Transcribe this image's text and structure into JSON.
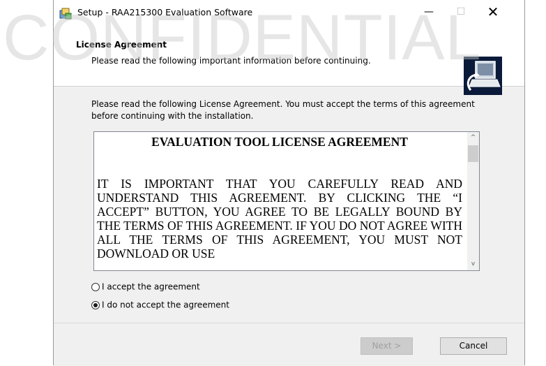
{
  "watermark": "CONFIDENTIAL",
  "window": {
    "title": "Setup - RAA215300 Evaluation Software",
    "minimize_glyph": "—",
    "maximize_glyph": "☐",
    "close_glyph": "✕"
  },
  "header": {
    "title": "License Agreement",
    "subtitle": "Please read the following important information before continuing."
  },
  "content": {
    "intro": "Please read the following License Agreement. You must accept the terms of this agreement before continuing with the installation.",
    "license_heading": "EVALUATION TOOL LICENSE AGREEMENT",
    "license_body": "IT IS IMPORTANT THAT YOU CAREFULLY READ AND UNDERSTAND THIS AGREEMENT. BY CLICKING THE “I ACCEPT” BUTTON, YOU AGREE TO BE LEGALLY BOUND BY THE TERMS OF THIS AGREEMENT. IF YOU DO NOT AGREE WITH ALL THE TERMS OF THIS AGREEMENT, YOU MUST NOT DOWNLOAD OR USE",
    "scroll_up_glyph": "^",
    "scroll_down_glyph": "v",
    "radio_accept": "I accept the agreement",
    "radio_decline": "I do not accept the agreement",
    "selected": "decline"
  },
  "footer": {
    "next_label": "Next >",
    "cancel_label": "Cancel"
  },
  "icons": {
    "app": "setup-installer-icon",
    "header": "computer-install-icon"
  }
}
